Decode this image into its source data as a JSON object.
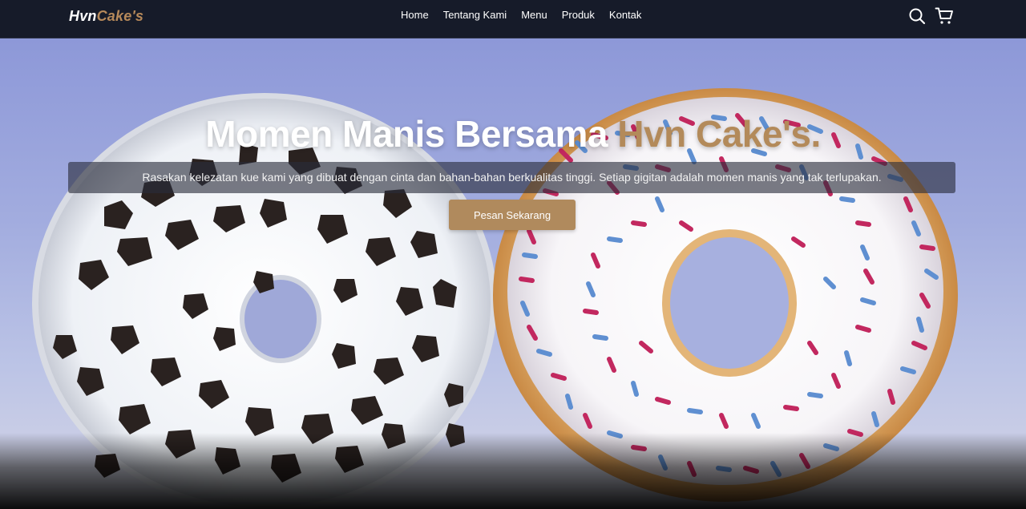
{
  "brand": {
    "part1": "Hvn",
    "part2": "Cake's"
  },
  "nav": {
    "links": [
      "Home",
      "Tentang Kami",
      "Menu",
      "Produk",
      "Kontak"
    ],
    "icons": [
      "search-icon",
      "shopping-cart-icon"
    ]
  },
  "hero": {
    "title_main": "Momen Manis Bersama ",
    "title_accent": "Hvn Cake's.",
    "subtitle": "Rasakan kelezatan kue kami yang dibuat dengan cinta dan bahan-bahan berkualitas tinggi. Setiap gigitan adalah momen manis yang tak terlupakan.",
    "cta_label": "Pesan Sekarang"
  },
  "colors": {
    "navbar_bg": "#161b29",
    "accent": "#b08a5d",
    "hero_sky": "#a3addf"
  }
}
